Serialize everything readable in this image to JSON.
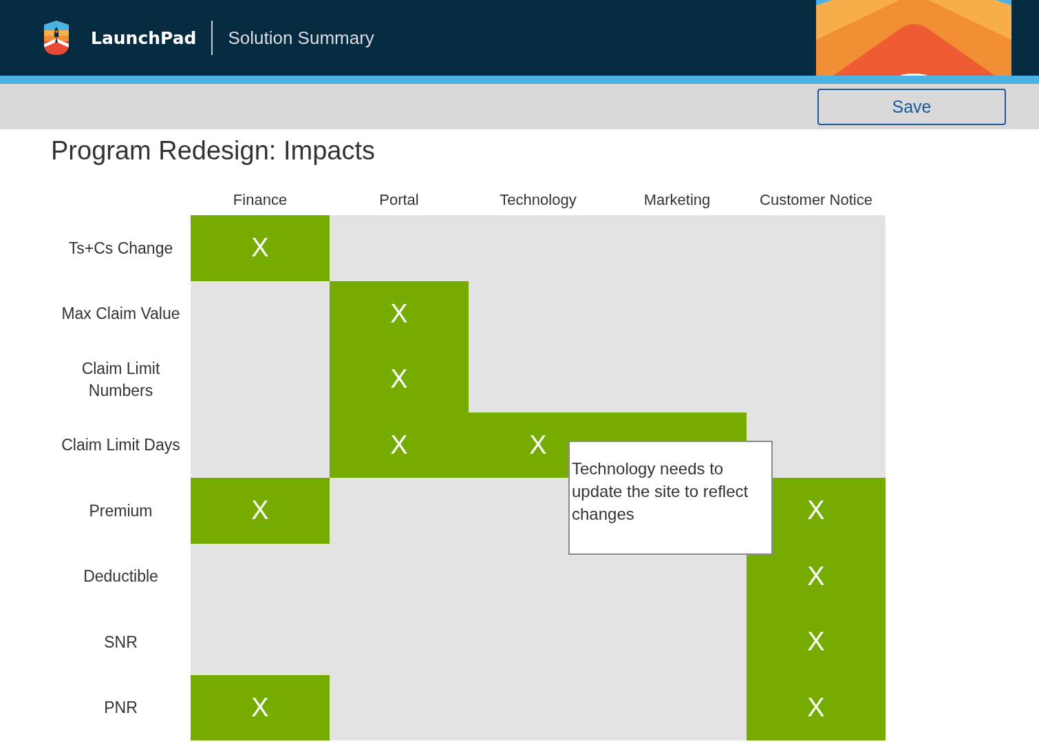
{
  "header": {
    "brand": "LaunchPad",
    "subtitle": "Solution Summary"
  },
  "toolbar": {
    "buttons": [
      "Save"
    ]
  },
  "title": "Program Redesign: Impacts",
  "table": {
    "columns": [
      "Finance",
      "Portal",
      "Technology",
      "Marketing",
      "Customer Notice"
    ],
    "rows": [
      {
        "label": "Ts+Cs Change",
        "cells": [
          {
            "marked": true,
            "text": "X"
          },
          {
            "marked": false
          },
          {
            "marked": false
          },
          {
            "marked": false
          },
          {
            "marked": false
          }
        ]
      },
      {
        "label": "Max Claim Value",
        "cells": [
          {
            "marked": false
          },
          {
            "marked": true,
            "text": "X"
          },
          {
            "marked": false
          },
          {
            "marked": false
          },
          {
            "marked": false
          }
        ]
      },
      {
        "label": "Claim Limit Numbers",
        "cells": [
          {
            "marked": false
          },
          {
            "marked": true,
            "text": "X"
          },
          {
            "marked": false
          },
          {
            "marked": false
          },
          {
            "marked": false
          }
        ]
      },
      {
        "label": "Claim Limit Days",
        "cells": [
          {
            "marked": false
          },
          {
            "marked": true,
            "text": "X"
          },
          {
            "marked": true,
            "text": "X"
          },
          {
            "marked": true
          },
          {
            "marked": false
          }
        ]
      },
      {
        "label": "Premium",
        "cells": [
          {
            "marked": true,
            "text": "X"
          },
          {
            "marked": false
          },
          {
            "marked": false
          },
          {},
          {
            "marked": true,
            "text": "X"
          }
        ]
      },
      {
        "label": "Deductible",
        "cells": [
          {
            "marked": false
          },
          {
            "marked": false
          },
          {
            "marked": false
          },
          {
            "marked": false
          },
          {
            "marked": true,
            "text": "X"
          }
        ]
      },
      {
        "label": "SNR",
        "cells": [
          {
            "marked": false
          },
          {
            "marked": false
          },
          {
            "marked": false
          },
          {
            "marked": false
          },
          {
            "marked": true,
            "text": "X"
          }
        ]
      },
      {
        "label": "PNR",
        "cells": [
          {
            "marked": true,
            "text": "X"
          },
          {
            "marked": false
          },
          {
            "marked": false
          },
          {
            "marked": false
          },
          {
            "marked": true,
            "text": "X"
          }
        ]
      }
    ]
  },
  "tooltip": {
    "text": "Technology needs to update the site to reflect changes"
  }
}
